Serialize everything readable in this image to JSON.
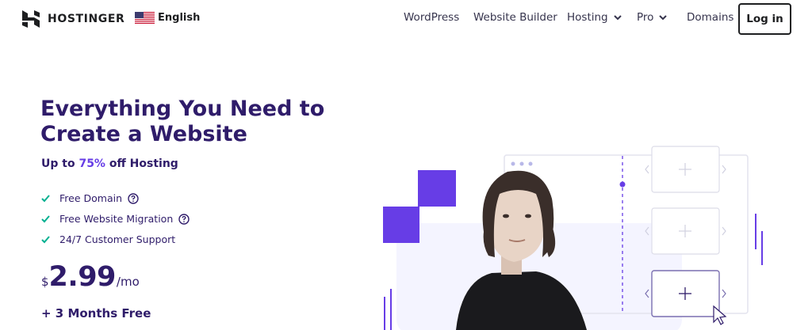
{
  "brand": {
    "name": "HOSTINGER",
    "logo_icon": "hostinger-logo-icon"
  },
  "language": {
    "label": "English",
    "flag_icon": "us-flag-icon"
  },
  "nav": {
    "items": [
      {
        "label": "WordPress",
        "has_dropdown": false
      },
      {
        "label": "Website Builder",
        "has_dropdown": false
      },
      {
        "label": "Hosting",
        "has_dropdown": true
      },
      {
        "label": "Pro",
        "has_dropdown": true
      },
      {
        "label": "Domains",
        "has_dropdown": false
      }
    ],
    "login_label": "Log in"
  },
  "hero": {
    "title": "Everything You Need to Create a Website",
    "subtitle_prefix": "Up to ",
    "subtitle_highlight": "75%",
    "subtitle_suffix": " off Hosting",
    "features": [
      {
        "label": "Free Domain",
        "has_help": true
      },
      {
        "label": "Free Website Migration",
        "has_help": true
      },
      {
        "label": "24/7 Customer Support",
        "has_help": false
      }
    ],
    "price": {
      "currency": "$",
      "amount": "2.99",
      "period": "/mo"
    },
    "bonus": "+ 3 Months Free"
  },
  "colors": {
    "brand_dark": "#2f1c6a",
    "accent": "#673de6",
    "check": "#00b090",
    "illustration_bg": "#f4f4ff"
  }
}
